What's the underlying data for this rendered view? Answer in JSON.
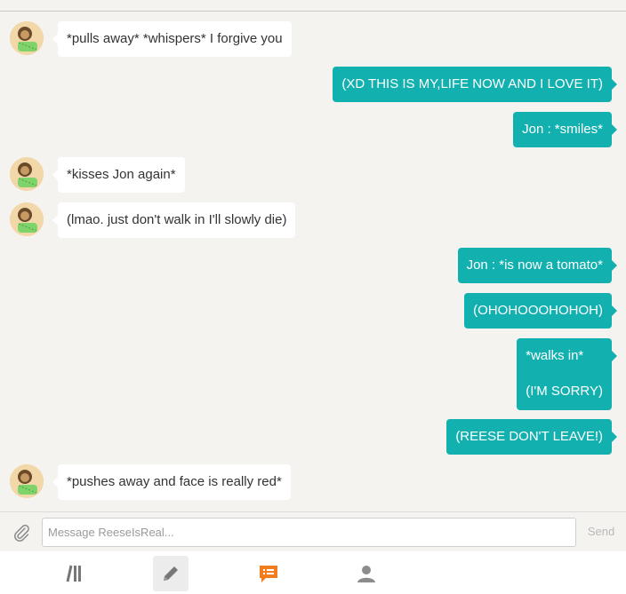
{
  "conversation": {
    "messages": [
      {
        "direction": "in",
        "lines": [
          "*pulls away* *whispers* I forgive you"
        ]
      },
      {
        "direction": "out",
        "lines": [
          "(XD THIS IS MY,LIFE NOW AND I LOVE IT)"
        ]
      },
      {
        "direction": "out",
        "lines": [
          "Jon : *smiles*"
        ]
      },
      {
        "direction": "in",
        "lines": [
          "*kisses Jon again*"
        ]
      },
      {
        "direction": "in",
        "lines": [
          "(lmao. just don't walk in I'll slowly die)"
        ]
      },
      {
        "direction": "out",
        "lines": [
          "Jon : *is now a tomato*"
        ]
      },
      {
        "direction": "out",
        "lines": [
          "(OHOHOOOHOHOH)"
        ]
      },
      {
        "direction": "out",
        "lines": [
          "*walks in*",
          "(I'M SORRY)"
        ]
      },
      {
        "direction": "out",
        "lines": [
          "(REESE DON'T LEAVE!)"
        ]
      },
      {
        "direction": "in",
        "lines": [
          "*pushes away and face is really red*"
        ]
      }
    ]
  },
  "composer": {
    "placeholder": "Message ReeseIsReal...",
    "send_label": "Send",
    "attach_icon": "paperclip-icon"
  },
  "tabbar": {
    "tabs": [
      {
        "icon": "library-icon"
      },
      {
        "icon": "pencil-icon",
        "active": true
      },
      {
        "icon": "chat-icon",
        "color": "#f27d1f"
      },
      {
        "icon": "profile-icon"
      }
    ]
  },
  "colors": {
    "outgoing_bubble": "#13b0b0",
    "incoming_bubble": "#ffffff",
    "background": "#f4f3f0",
    "accent": "#f27d1f"
  }
}
